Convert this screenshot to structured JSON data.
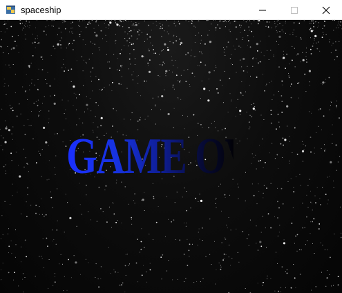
{
  "window": {
    "title": "spaceship",
    "app_icon": "python-icon",
    "controls": [
      "minimize-icon",
      "maximize-icon",
      "close-icon"
    ]
  },
  "game": {
    "message": "GAME OVER",
    "background": "starfield",
    "colors": {
      "text_start": "#1a2fff",
      "text_end": "#020208",
      "background": "#050505"
    }
  }
}
